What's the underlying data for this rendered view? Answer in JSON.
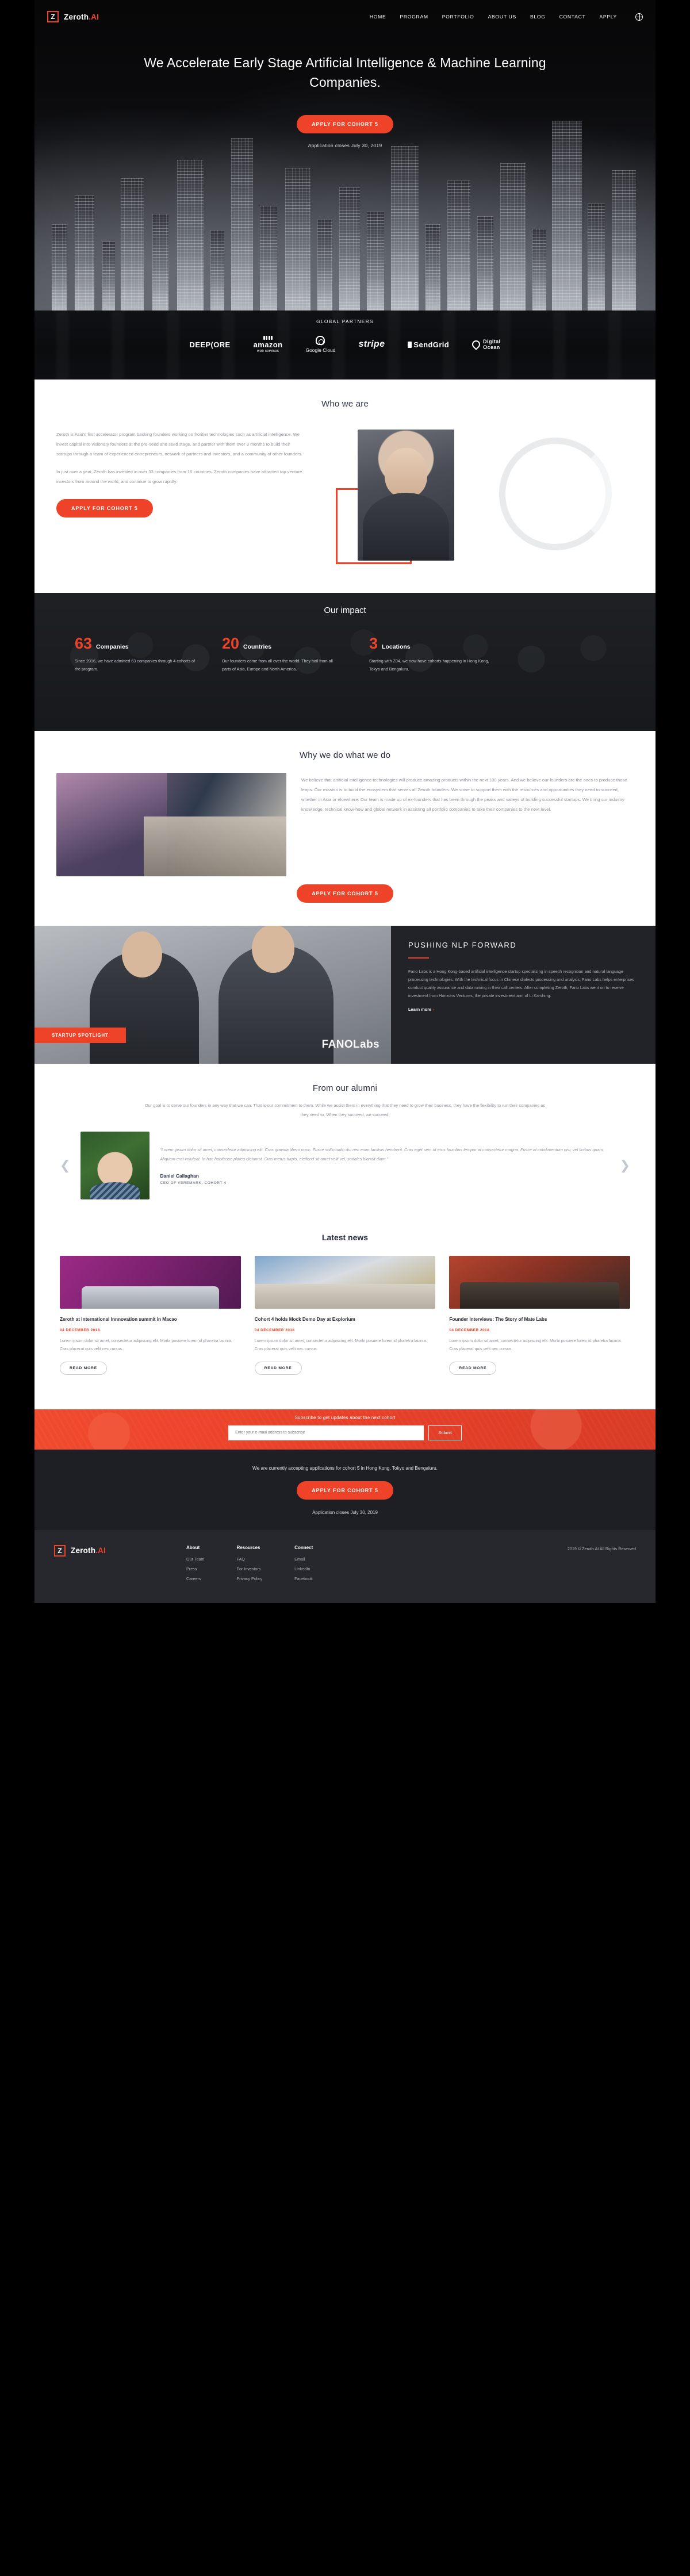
{
  "nav": {
    "brand": "Zeroth",
    "brand_suffix": ".AI",
    "logo_glyph": "Z",
    "links": [
      "HOME",
      "PROGRAM",
      "PORTFOLIO",
      "ABOUT US",
      "BLOG",
      "CONTACT",
      "APPLY"
    ],
    "language_icon": "globe-icon"
  },
  "hero": {
    "headline": "We Accelerate Early Stage Artificial Intelligence & Machine Learning Companies.",
    "cta": "APPLY FOR COHORT 5",
    "note": "Application closes July 30, 2019"
  },
  "partners": {
    "title": "GLOBAL PARTNERS",
    "items": [
      {
        "name": "DEEP(ORE",
        "sub": ""
      },
      {
        "name": "amazon",
        "sub": "web services"
      },
      {
        "name": "Google Cloud",
        "sub": ""
      },
      {
        "name": "stripe",
        "sub": ""
      },
      {
        "name": "SendGrid",
        "sub": ""
      },
      {
        "name": "Digital",
        "sub": "Ocean"
      }
    ]
  },
  "who": {
    "title": "Who we are",
    "p1": "Zeroth is Asia's first accelerator program backing founders working on frontier technologies such as artificial intelligence.  We invest capital into visionary founders at the pre-seed and seed stage, and partner with them over 3 months to build their startups through a team of experienced entrepreneurs, network of partners and investors, and a community of other founders.",
    "p2": "In just over a year, Zeroth has invested in over 33 companies from 15 countries. Zeroth companies have attracted top venture investors  from around the world, and continue to grow rapidly.",
    "cta": "APPLY FOR COHORT 5"
  },
  "impact": {
    "title": "Our impact",
    "stats": [
      {
        "number": "63",
        "label": "Companies",
        "desc": "Since 2016, we have admitted 63 companies through 4 cohorts of the program."
      },
      {
        "number": "20",
        "label": "Countries",
        "desc": "Our founders come from all over the world. They hail from all parts of Asia, Europe and North America."
      },
      {
        "number": "3",
        "label": "Locations",
        "desc": "Starting with Z04, we now have cohorts happening in Hong Kong, Tokyo and Bengaluru."
      }
    ]
  },
  "why": {
    "title": "Why we do what we do",
    "body": "We believe that artificial intelligence technologies will produce amazing products within the next 100 years. And we believe our founders are the ones to produce those leaps. Our mission is to build the ecosystem that serves all Zeroth founders. We strive to support them with the resources and opportunities they need to succeed, whether in Asia or elsewhere. Our team is made up of ex-founders that has been through the peaks and valleys of building successful startups. We bring our industry knowledge, technical know-how and global network in assisting all portfolio companies to take their companies to the next level.",
    "cta": "APPLY FOR COHORT 5"
  },
  "spotlight": {
    "badge": "STARTUP SPOTLIGHT",
    "company_logo": "FANOLabs",
    "title": "PUSHING NLP FORWARD",
    "body": "Fano Labs is a Hong Kong-based artificial intelligence startup specializing in speech recognition and natural language processing technologies. With the technical focus in Chinese dialects processing and analysis, Fano Labs helps enterprises conduct quality assurance and data mining in their call centers.  After completing Zeroth, Fano Labs went on to receive investment from Horizons Ventures, the private investment arm of Li Ka-shing.",
    "learn_more": "Learn more"
  },
  "alumni": {
    "title": "From our alumni",
    "subtitle": "Our goal is to serve our founders in any way that we can. That is our commitment to them. While we assist them in everything that they need to grow their business, they have the flexibility to run their companies as they need to. When they succeed, we succeed.",
    "prev_icon": "chevron-left-icon",
    "next_icon": "chevron-right-icon",
    "quote": "“Lorem ipsum dolor sit amet, consectetur adipiscing elit. Cras gravida libero nunc. Fusce sollicitudin dui nec enim facilisis hendrerit. Cras eget sem ut eros faucibus tempor at consectetur magna. Fusce at condimentum nisi, vel finibus quam. Aliquam erat volutpat. In hac habitasse platea dictumst. Cras metus turpis, eleifend sit amet velit vel, sodales blandit diam.”",
    "name": "Daniel Callaghan",
    "role": "CEO OF VEREMARK, COHORT 4"
  },
  "news": {
    "title": "Latest news",
    "read_more": "READ MORE",
    "cards": [
      {
        "title": "Zeroth at International Innnovation summit in Macao",
        "date": "04 DECEMBER 2018",
        "excerpt": "Lorem ipsum dolor sit amet, consectetur adipiscing elit. Morbi posuere lorem id pharetra lacinia. Cras placerat quis velit nec cursus."
      },
      {
        "title": "Cohort 4 holds Mock Demo Day at Explorium",
        "date": "04 DECEMBER 2018",
        "excerpt": "Lorem ipsum dolor sit amet, consectetur adipiscing elit. Morbi posuere lorem id pharetra lacinia. Cras placerat quis velit nec cursus."
      },
      {
        "title": "Founder Interviews: The Story of Mate Labs",
        "date": "04 DECEMBER 2018",
        "excerpt": "Lorem ipsum dolor sit amet, consectetur adipiscing elit. Morbi posuere lorem id pharetra lacinia. Cras placerat quis velit nec cursus."
      }
    ]
  },
  "subscribe": {
    "label": "Subscribe to get updates about the next cohort",
    "placeholder": "Enter your e-maiil address to subscribe",
    "value": "",
    "submit": "Submit"
  },
  "apply_band": {
    "text": "We are currently accepting applications for cohort 5 in Hong Kong, Tokyo and Bengaluru.",
    "cta": "APPLY FOR COHORT 5",
    "closes": "Application closes July 30, 2019"
  },
  "footer": {
    "brand": "Zeroth",
    "brand_suffix": ".AI",
    "logo_glyph": "Z",
    "columns": [
      {
        "heading": "About",
        "links": [
          "Our Team",
          "Press",
          "Careers"
        ]
      },
      {
        "heading": "Resources",
        "links": [
          "FAQ",
          "For Investors",
          "Privacy Policy"
        ]
      },
      {
        "heading": "Connect",
        "links": [
          "Email",
          "LinkedIn",
          "Facebook"
        ]
      }
    ],
    "copyright": "2019 © Zeroth AI All Rights Reserved"
  },
  "colors": {
    "accent": "#ee4328",
    "dark": "#26282e",
    "ink": "#2b2f45",
    "muted": "#9296a0"
  }
}
